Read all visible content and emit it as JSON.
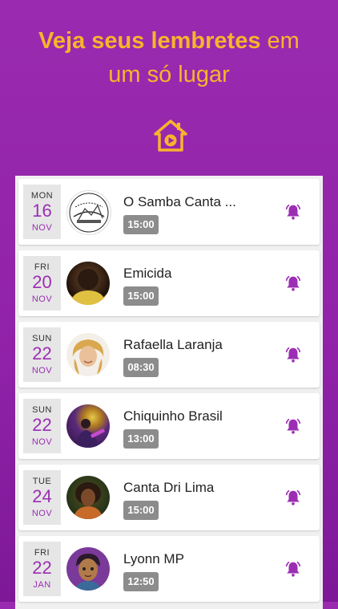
{
  "header": {
    "title_bold": "Veja seus lembretes",
    "title_light_1": " em",
    "title_light_2": "um só lugar"
  },
  "colors": {
    "accent": "#f7b42c",
    "primary": "#9b2eb3",
    "time_badge": "#8c8c8c"
  },
  "icons": {
    "header": "home-play-icon",
    "reminder": "bell-icon"
  },
  "reminders": [
    {
      "dow": "MON",
      "day": "16",
      "mon": "NOV",
      "name": "O Samba Canta ...",
      "time": "15:00",
      "avatar_icon": "samba-logo"
    },
    {
      "dow": "FRI",
      "day": "20",
      "mon": "NOV",
      "name": "Emicida",
      "time": "15:00",
      "avatar_icon": "artist-photo"
    },
    {
      "dow": "SUN",
      "day": "22",
      "mon": "NOV",
      "name": "Rafaella Laranja",
      "time": "08:30",
      "avatar_icon": "artist-photo"
    },
    {
      "dow": "SUN",
      "day": "22",
      "mon": "NOV",
      "name": "Chiquinho Brasil",
      "time": "13:00",
      "avatar_icon": "artist-photo"
    },
    {
      "dow": "TUE",
      "day": "24",
      "mon": "NOV",
      "name": "Canta Dri Lima",
      "time": "15:00",
      "avatar_icon": "artist-photo"
    },
    {
      "dow": "FRI",
      "day": "22",
      "mon": "JAN",
      "name": "Lyonn MP",
      "time": "12:50",
      "avatar_icon": "cartoon-avatar"
    }
  ]
}
